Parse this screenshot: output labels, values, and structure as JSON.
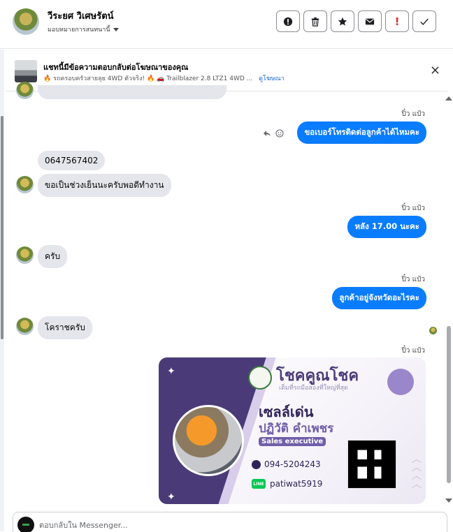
{
  "header": {
    "name": "วีระยศ วิเศษรัตน์",
    "assign_label": "มอบหมายการสนทนานี้",
    "actions": [
      {
        "icon": "alert-circle-icon"
      },
      {
        "icon": "trash-icon"
      },
      {
        "icon": "star-icon"
      },
      {
        "icon": "mail-icon"
      },
      {
        "icon": "exclamation-icon",
        "glyph": "!"
      },
      {
        "icon": "check-icon"
      }
    ]
  },
  "ad": {
    "title": "แชทนี้มีข้อความตอบกลับต่อโฆษณาของคุณ",
    "description": "🔥 รถครอบครัวสายลุย 4WD ตัวจริง! 🔥 🚗 Trailblazer 2.8 LTZ1 4WD ...",
    "link": "ดูโฆษณา"
  },
  "messages": {
    "stamp1": "ปิ๋ว แป๋ว",
    "out1": "ขอเบอร์โทรติดต่อลูกค้าได้ไหมคะ",
    "in1": "0647567402",
    "in2": "ขอเป็นช่วงเย็นนะครับพอดีทำงาน",
    "stamp2": "ปิ๋ว แป๋ว",
    "out2": "หลัง 17.00 นะคะ",
    "in3": "ครับ",
    "stamp3": "ปิ๋ว แป๋ว",
    "out3": "ลูกค้าอยู่จังหวัดอะไรคะ",
    "in4": "โคราชครับ",
    "stamp4": "ปิ๋ว แป๋ว"
  },
  "card": {
    "brand": "โชคคูณโชค",
    "tagline": "เต็มที่รถมือสองที่ใหญ่ที่สุด",
    "title": "เซลล์เด่น",
    "person": "ปฏิวัติ คำเพชร",
    "role": "Sales executive",
    "phone": "094-5204243",
    "line_badge": "LINE",
    "line_id": "patiwat5919"
  },
  "composer": {
    "placeholder": "ตอบกลับใน Messenger..."
  },
  "colors": {
    "outgoing_bubble": "#0a7cff",
    "incoming_bubble": "#e4e6eb",
    "card_accent": "#4a3b78"
  }
}
